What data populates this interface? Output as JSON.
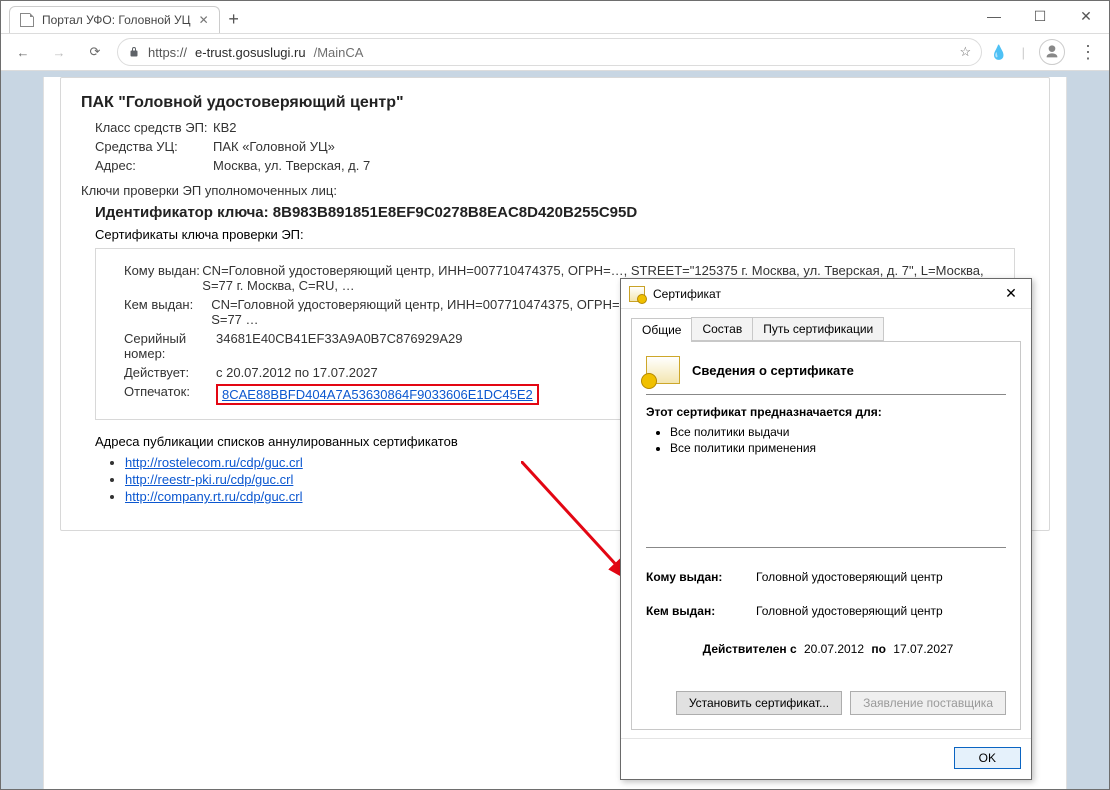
{
  "browser": {
    "tab_title": "Портал УФО: Головной УЦ",
    "url_scheme": "https://",
    "url_host": "e-trust.gosuslugi.ru",
    "url_path": "/MainCA"
  },
  "page": {
    "org_title": "ПАК \"Головной удостоверяющий центр\"",
    "rows": {
      "ep_class_label": "Класс средств ЭП:",
      "ep_class_value": "КВ2",
      "uc_means_label": "Средства УЦ:",
      "uc_means_value": "ПАК «Головной УЦ»",
      "address_label": "Адрес:",
      "address_value": "Москва, ул. Тверская, д. 7"
    },
    "keys_caption": "Ключи проверки ЭП уполномоченных лиц:",
    "key_id_label": "Идентификатор ключа: ",
    "key_id_value": "8B983B891851E8EF9C0278B8EAC8D420B255C95D",
    "certs_caption": "Сертификаты ключа проверки ЭП:",
    "cert": {
      "subject_label": "Кому выдан:",
      "subject_value": "CN=Головной удостоверяющий центр, ИНН=007710474375, ОГРН=…, STREET=\"125375 г. Москва, ул. Тверская, д. 7\", L=Москва, S=77 г. Москва, C=RU, …",
      "issuer_label": "Кем выдан:",
      "issuer_value": "CN=Головной удостоверяющий центр, ИНН=007710474375, ОГРН=…, STREET=\"125375 г. Москва, ул. Тверская, д. 7\", L=Москва, S=77 …",
      "serial_label": "Серийный номер:",
      "serial_value": "34681E40CB41EF33A9A0B7C876929A29",
      "valid_label": "Действует:",
      "valid_value": "с 20.07.2012 по 17.07.2027",
      "fp_label": "Отпечаток:",
      "fp_value": "8CAE88BBFD404A7A53630864F9033606E1DC45E2"
    },
    "crl_caption": "Адреса публикации списков аннулированных сертификатов",
    "crl_links": [
      "http://rostelecom.ru/cdp/guc.crl",
      "http://reestr-pki.ru/cdp/guc.crl",
      "http://company.rt.ru/cdp/guc.crl"
    ]
  },
  "dialog": {
    "title": "Сертификат",
    "tabs": {
      "general": "Общие",
      "composition": "Состав",
      "path": "Путь сертификации"
    },
    "heading": "Сведения о сертификате",
    "purpose_caption": "Этот сертификат предназначается для:",
    "purpose_items": [
      "Все политики выдачи",
      "Все политики применения"
    ],
    "subject_label": "Кому выдан:",
    "subject_value": "Головной удостоверяющий центр",
    "issuer_label": "Кем выдан:",
    "issuer_value": "Головной удостоверяющий центр",
    "valid_prefix": "Действителен с",
    "valid_from": "20.07.2012",
    "valid_to_word": "по",
    "valid_to": "17.07.2027",
    "install_btn": "Установить сертификат...",
    "issuer_stmt_btn": "Заявление поставщика",
    "ok_btn": "OK"
  }
}
